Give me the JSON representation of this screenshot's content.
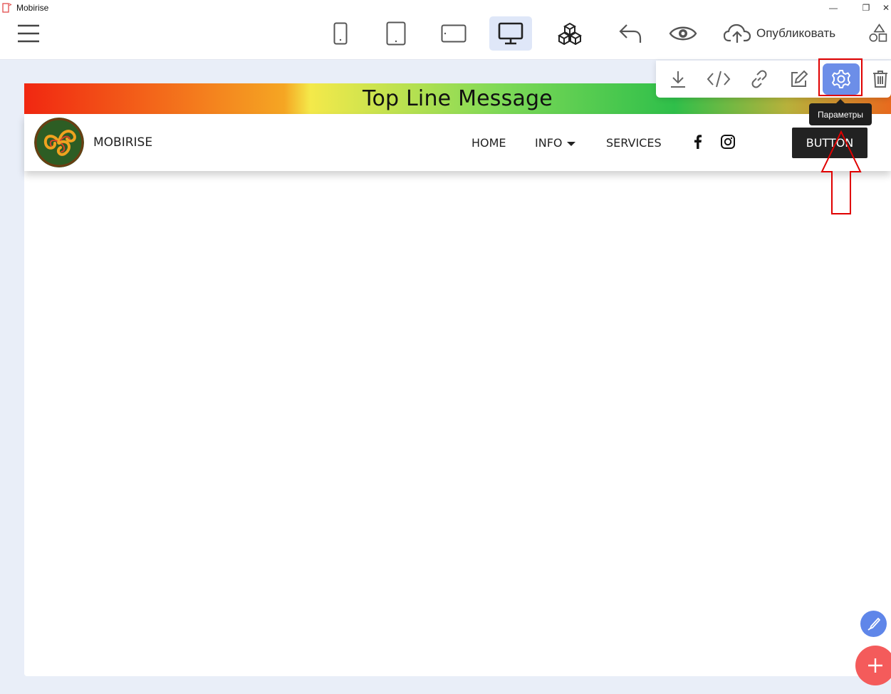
{
  "window": {
    "title": "Mobirise",
    "minimize_glyph": "—",
    "restore_glyph": "❐",
    "close_glyph": "✕"
  },
  "toolbar": {
    "menu_icon": "hamburger-icon",
    "devices": [
      "phone-icon",
      "tablet-icon",
      "tablet-landscape-icon",
      "desktop-icon"
    ],
    "active_device": "desktop",
    "extensions_icon": "cubes-icon",
    "undo_icon": "undo-icon",
    "preview_icon": "eye-icon",
    "publish_label": "Опубликовать",
    "shapes_icon": "shapes-icon"
  },
  "block_tools": {
    "items": [
      "download-icon",
      "code-icon",
      "link-icon",
      "edit-icon",
      "gear-icon",
      "trash-icon"
    ],
    "active": "gear-icon",
    "tooltip": "Параметры"
  },
  "page": {
    "top_line_message": "Top Line Message",
    "brand": "MOBIRISE",
    "nav": {
      "home": "HOME",
      "info": "INFO",
      "services": "SERVICES"
    },
    "social": [
      "facebook-icon",
      "instagram-icon"
    ],
    "button_label": "BUTTON"
  },
  "colors": {
    "accent": "#6c8ee8",
    "annotation": "#e00000",
    "add_button": "#f45b5b",
    "edit_button": "#5f86e9"
  }
}
